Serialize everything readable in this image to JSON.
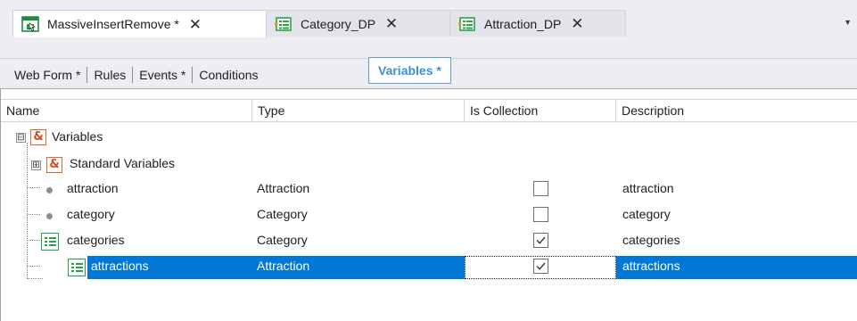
{
  "doc_tabs": [
    {
      "label": "MassiveInsertRemove *",
      "icon": "webpanel-icon",
      "active": true
    },
    {
      "label": "Category_DP",
      "icon": "data-provider-icon",
      "active": false
    },
    {
      "label": "Attraction_DP",
      "icon": "data-provider-icon",
      "active": false
    }
  ],
  "close_glyph": "✕",
  "dropdown_glyph": "▼",
  "sub_tabs": [
    "Web Form *",
    "Rules",
    "Events *",
    "Conditions",
    "Variables *"
  ],
  "selected_sub_tab": "Variables *",
  "columns": [
    "Name",
    "Type",
    "Is Collection",
    "Description"
  ],
  "tree": {
    "root": {
      "label": "Variables",
      "expander": "⊟",
      "icon": "ampersand-icon",
      "icon_glyph": "&"
    },
    "standard": {
      "label": "Standard Variables",
      "expander": "⊞",
      "icon": "ampersand-icon",
      "icon_glyph": "&"
    }
  },
  "rows": [
    {
      "name": "attraction",
      "type": "Attraction",
      "is_collection": false,
      "description": "attraction",
      "icon": "variable-dot-icon",
      "selected": false
    },
    {
      "name": "category",
      "type": "Category",
      "is_collection": false,
      "description": "category",
      "icon": "variable-dot-icon",
      "selected": false
    },
    {
      "name": "categories",
      "type": "Category",
      "is_collection": true,
      "description": "categories",
      "icon": "collection-icon",
      "selected": false
    },
    {
      "name": "attractions",
      "type": "Attraction",
      "is_collection": true,
      "description": "attractions",
      "icon": "collection-icon",
      "selected": true
    }
  ],
  "colors": {
    "selection": "#0078d7",
    "accent_tab": "#3c8fd3",
    "ampersand": "#e8622b",
    "collection": "#2aa14a"
  }
}
